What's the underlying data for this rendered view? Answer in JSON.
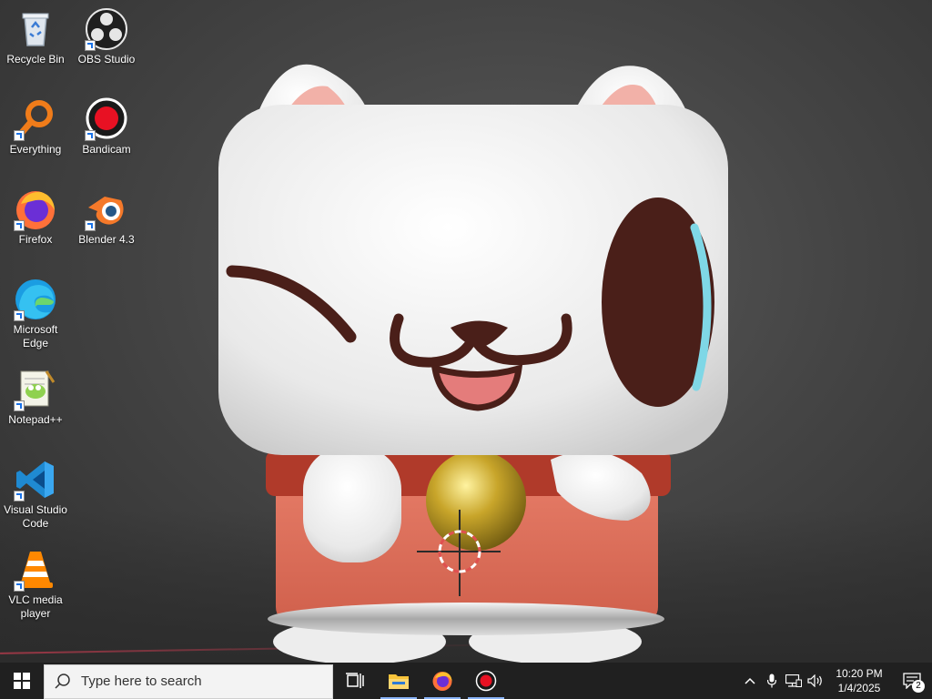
{
  "desktop": {
    "icons": [
      {
        "label": "Recycle Bin",
        "icon": "recycle-bin-icon"
      },
      {
        "label": "OBS Studio",
        "icon": "obs-studio-icon"
      },
      {
        "label": "Everything",
        "icon": "everything-search-icon"
      },
      {
        "label": "Bandicam",
        "icon": "bandicam-icon"
      },
      {
        "label": "Firefox",
        "icon": "firefox-icon"
      },
      {
        "label": "Blender 4.3",
        "icon": "blender-icon"
      },
      {
        "label": "Microsoft Edge",
        "icon": "edge-icon"
      },
      {
        "label": "Notepad++",
        "icon": "notepad-plus-plus-icon"
      },
      {
        "label": "Visual Studio Code",
        "icon": "vscode-icon"
      },
      {
        "label": "VLC media player",
        "icon": "vlc-icon"
      }
    ]
  },
  "taskbar": {
    "search_placeholder": "Type here to search",
    "pinned": [
      {
        "name": "task-view",
        "icon": "task-view-icon"
      },
      {
        "name": "file-explorer",
        "icon": "folder-icon"
      },
      {
        "name": "firefox",
        "icon": "firefox-icon"
      },
      {
        "name": "bandicam",
        "icon": "bandicam-icon"
      }
    ],
    "clock": {
      "time": "10:20 PM",
      "date": "1/4/2025"
    },
    "notification_count": "2"
  },
  "colors": {
    "taskbar": "#202020",
    "accent": "#8ab4f8",
    "bandicam_red": "#e81123"
  }
}
